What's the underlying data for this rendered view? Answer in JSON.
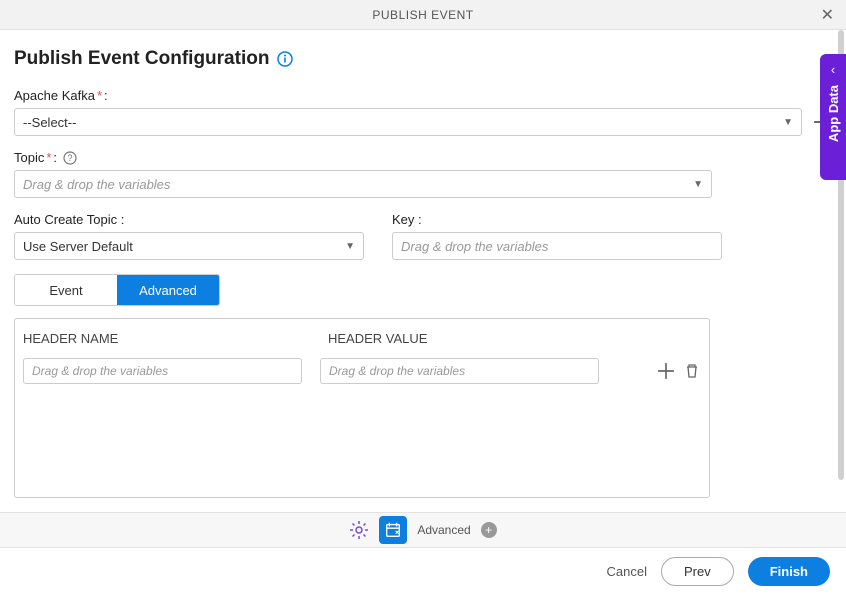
{
  "modal": {
    "title": "PUBLISH EVENT"
  },
  "config": {
    "title": "Publish Event Configuration"
  },
  "fields": {
    "kafka": {
      "label": "Apache Kafka",
      "value": "--Select--"
    },
    "topic": {
      "label": "Topic",
      "placeholder": "Drag & drop the variables"
    },
    "autoCreate": {
      "label": "Auto Create Topic :",
      "value": "Use Server Default"
    },
    "key": {
      "label": "Key :",
      "placeholder": "Drag & drop the variables"
    }
  },
  "tabs": {
    "event": "Event",
    "advanced": "Advanced"
  },
  "headers": {
    "colName": "HEADER NAME",
    "colValue": "HEADER VALUE",
    "placeholder": "Drag & drop the variables"
  },
  "toolbar": {
    "advanced": "Advanced"
  },
  "sidebar": {
    "appData": "App Data"
  },
  "footer": {
    "cancel": "Cancel",
    "prev": "Prev",
    "finish": "Finish"
  }
}
